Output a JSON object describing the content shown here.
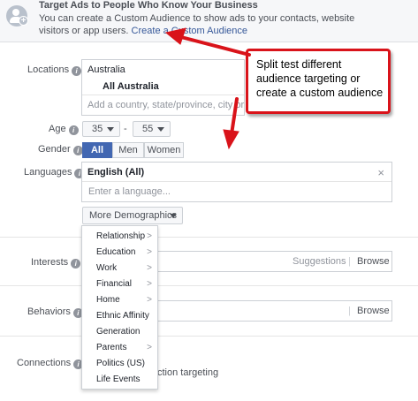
{
  "banner": {
    "title": "Target Ads to People Who Know Your Business",
    "text_prefix": "You can create a Custom Audience to show ads to your contacts, website visitors or app users. ",
    "link": "Create a Custom Audience"
  },
  "locations": {
    "label": "Locations",
    "country": "Australia",
    "selected": "All Australia",
    "placeholder": "Add a country, state/province, city or ZIP"
  },
  "age": {
    "label": "Age",
    "min": "35",
    "separator": "-",
    "max": "55"
  },
  "gender": {
    "label": "Gender",
    "options": [
      "All",
      "Men",
      "Women"
    ],
    "selected": "All"
  },
  "languages": {
    "label": "Languages",
    "selected": "English (All)",
    "remove": "×",
    "placeholder": "Enter a language..."
  },
  "more_demographics": {
    "label": "More Demographics",
    "items": [
      {
        "label": "Relationship",
        "submenu": true
      },
      {
        "label": "Education",
        "submenu": true
      },
      {
        "label": "Work",
        "submenu": true
      },
      {
        "label": "Financial",
        "submenu": true
      },
      {
        "label": "Home",
        "submenu": true
      },
      {
        "label": "Ethnic Affinity",
        "submenu": false
      },
      {
        "label": "Generation",
        "submenu": false
      },
      {
        "label": "Parents",
        "submenu": true
      },
      {
        "label": "Politics (US)",
        "submenu": false
      },
      {
        "label": "Life Events",
        "submenu": false
      }
    ]
  },
  "interests": {
    "label": "Interests",
    "suggestions": "Suggestions",
    "separator": "|",
    "browse": "Browse"
  },
  "behaviors": {
    "label": "Behaviors",
    "browse": "Browse"
  },
  "connections": {
    "label": "Connections",
    "partial_text": "ction targeting"
  },
  "callout": {
    "text": "Split test different audience targeting or create a custom audience",
    "color": "#d9131a"
  },
  "colors": {
    "link": "#365899",
    "active": "#4267b2"
  },
  "icons": {
    "info": "i",
    "chevron": ">",
    "custom_audience": "people-plus-icon"
  }
}
